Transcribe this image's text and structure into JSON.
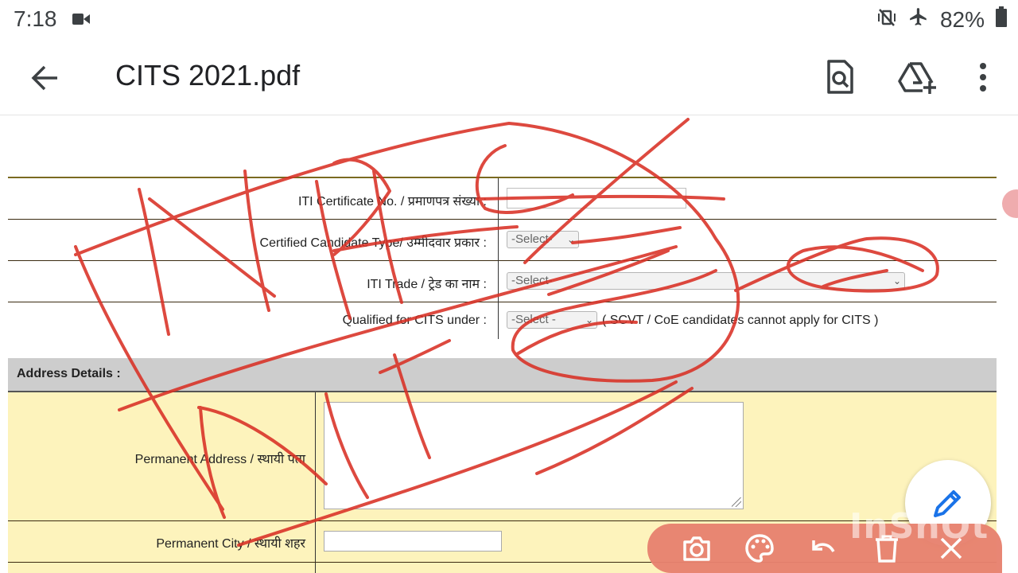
{
  "status": {
    "time": "7:18",
    "battery": "82%"
  },
  "app": {
    "title": "CITS 2021.pdf"
  },
  "form": {
    "iti_cert_label": "ITI Certificate No. / प्रमाणपत्र संख्या :",
    "cand_type_label": "Certified Candidate Type/ उम्मीदवार प्रकार :",
    "cand_type_value": "-Select-",
    "trade_label": "ITI Trade / ट्रेड का नाम :",
    "trade_value": "-Select-",
    "qualified_label": "Qualified for CITS under :",
    "qualified_value": "-Select -",
    "qualified_note": "( SCVT / CoE candidates cannot apply for CITS )",
    "address_header": "Address Details :",
    "perm_address_label": "Permanent Address / स्थायी पता",
    "perm_city_label": "Permanent City / स्थायी शहर"
  },
  "watermark": "InShOt",
  "icons": {
    "back": "arrow-left-icon",
    "search_doc": "document-search-icon",
    "drive_add": "drive-add-icon",
    "more": "more-vert-icon",
    "edit": "pencil-icon",
    "camera": "camera-icon",
    "palette": "palette-icon",
    "undo": "undo-icon",
    "delete": "trash-icon",
    "close": "close-icon"
  },
  "colors": {
    "ink": "#d93025",
    "form_yellow": "#fdf3bc",
    "toolbar": "#e8826f"
  }
}
